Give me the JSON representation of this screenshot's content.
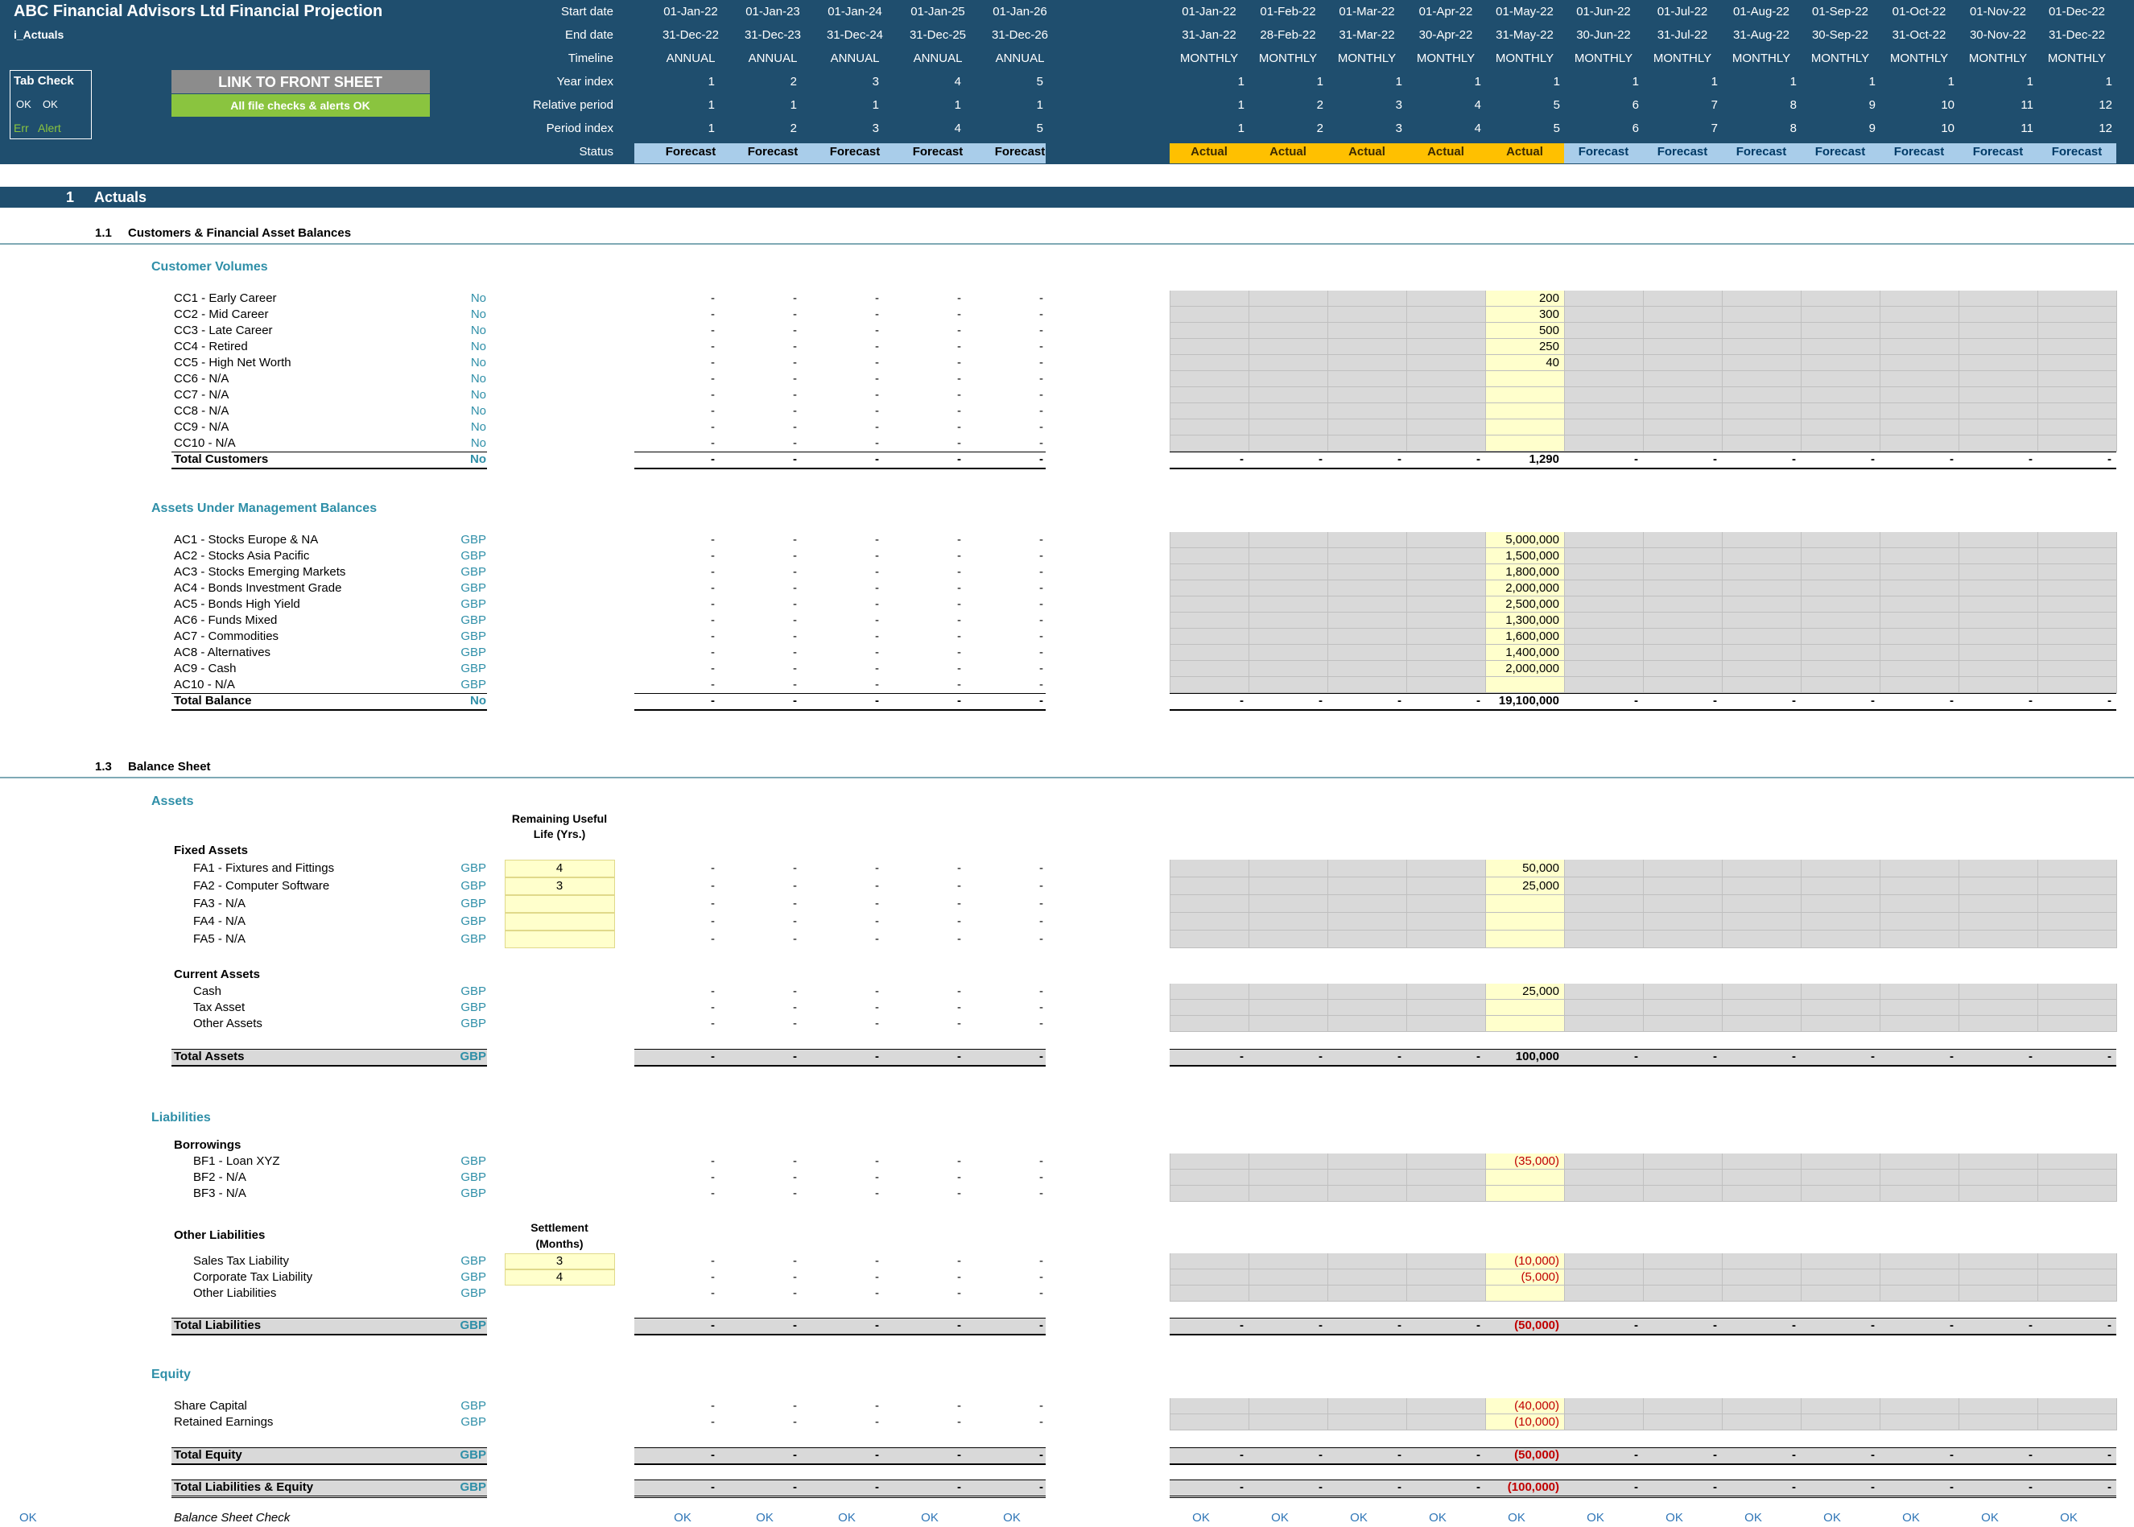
{
  "header": {
    "title": "ABC Financial Advisors Ltd Financial Projection",
    "sheet_name": "i_Actuals",
    "tab_check": {
      "title": "Tab Check",
      "ok_label": "OK",
      "ok_value": "OK",
      "err_label": "Err",
      "err_value": "Alert"
    },
    "link_button": "LINK TO FRONT SHEET",
    "checks_status": "All file checks & alerts OK",
    "row_labels": {
      "start": "Start date",
      "end": "End date",
      "timeline": "Timeline",
      "year_index": "Year index",
      "relative": "Relative period",
      "period_index": "Period index",
      "status": "Status"
    }
  },
  "annual_periods": [
    {
      "start": "01-Jan-22",
      "end": "31-Dec-22",
      "timeline": "ANNUAL",
      "year": "1",
      "relative": "1",
      "period": "1",
      "status": "Forecast"
    },
    {
      "start": "01-Jan-23",
      "end": "31-Dec-23",
      "timeline": "ANNUAL",
      "year": "2",
      "relative": "1",
      "period": "2",
      "status": "Forecast"
    },
    {
      "start": "01-Jan-24",
      "end": "31-Dec-24",
      "timeline": "ANNUAL",
      "year": "3",
      "relative": "1",
      "period": "3",
      "status": "Forecast"
    },
    {
      "start": "01-Jan-25",
      "end": "31-Dec-25",
      "timeline": "ANNUAL",
      "year": "4",
      "relative": "1",
      "period": "4",
      "status": "Forecast"
    },
    {
      "start": "01-Jan-26",
      "end": "31-Dec-26",
      "timeline": "ANNUAL",
      "year": "5",
      "relative": "1",
      "period": "5",
      "status": "Forecast"
    }
  ],
  "monthly_periods": [
    {
      "start": "01-Jan-22",
      "end": "31-Jan-22",
      "timeline": "MONTHLY",
      "year": "1",
      "relative": "1",
      "period": "1",
      "status": "Actual"
    },
    {
      "start": "01-Feb-22",
      "end": "28-Feb-22",
      "timeline": "MONTHLY",
      "year": "1",
      "relative": "2",
      "period": "2",
      "status": "Actual"
    },
    {
      "start": "01-Mar-22",
      "end": "31-Mar-22",
      "timeline": "MONTHLY",
      "year": "1",
      "relative": "3",
      "period": "3",
      "status": "Actual"
    },
    {
      "start": "01-Apr-22",
      "end": "30-Apr-22",
      "timeline": "MONTHLY",
      "year": "1",
      "relative": "4",
      "period": "4",
      "status": "Actual"
    },
    {
      "start": "01-May-22",
      "end": "31-May-22",
      "timeline": "MONTHLY",
      "year": "1",
      "relative": "5",
      "period": "5",
      "status": "Actual"
    },
    {
      "start": "01-Jun-22",
      "end": "30-Jun-22",
      "timeline": "MONTHLY",
      "year": "1",
      "relative": "6",
      "period": "6",
      "status": "Forecast"
    },
    {
      "start": "01-Jul-22",
      "end": "31-Jul-22",
      "timeline": "MONTHLY",
      "year": "1",
      "relative": "7",
      "period": "7",
      "status": "Forecast"
    },
    {
      "start": "01-Aug-22",
      "end": "31-Aug-22",
      "timeline": "MONTHLY",
      "year": "1",
      "relative": "8",
      "period": "8",
      "status": "Forecast"
    },
    {
      "start": "01-Sep-22",
      "end": "30-Sep-22",
      "timeline": "MONTHLY",
      "year": "1",
      "relative": "9",
      "period": "9",
      "status": "Forecast"
    },
    {
      "start": "01-Oct-22",
      "end": "31-Oct-22",
      "timeline": "MONTHLY",
      "year": "1",
      "relative": "10",
      "period": "10",
      "status": "Forecast"
    },
    {
      "start": "01-Nov-22",
      "end": "30-Nov-22",
      "timeline": "MONTHLY",
      "year": "1",
      "relative": "11",
      "period": "11",
      "status": "Forecast"
    },
    {
      "start": "01-Dec-22",
      "end": "31-Dec-22",
      "timeline": "MONTHLY",
      "year": "1",
      "relative": "12",
      "period": "12",
      "status": "Forecast"
    }
  ],
  "section": {
    "number": "1",
    "title": "Actuals"
  },
  "subsections": [
    {
      "number": "1.1",
      "title": "Customers & Financial Asset Balances"
    },
    {
      "number": "1.3",
      "title": "Balance Sheet"
    }
  ],
  "blocks": {
    "customer_volumes": {
      "title": "Customer Volumes",
      "rows": [
        {
          "label": "CC1 - Early Career",
          "unit": "No",
          "input": "200"
        },
        {
          "label": "CC2 - Mid Career",
          "unit": "No",
          "input": "300"
        },
        {
          "label": "CC3 - Late Career",
          "unit": "No",
          "input": "500"
        },
        {
          "label": "CC4 - Retired",
          "unit": "No",
          "input": "250"
        },
        {
          "label": "CC5 - High Net Worth",
          "unit": "No",
          "input": "40"
        },
        {
          "label": "CC6 - N/A",
          "unit": "No",
          "input": ""
        },
        {
          "label": "CC7 - N/A",
          "unit": "No",
          "input": ""
        },
        {
          "label": "CC8 - N/A",
          "unit": "No",
          "input": ""
        },
        {
          "label": "CC9 - N/A",
          "unit": "No",
          "input": ""
        },
        {
          "label": "CC10 - N/A",
          "unit": "No",
          "input": ""
        }
      ],
      "total": {
        "label": "Total Customers",
        "unit": "No",
        "value": "1,290"
      }
    },
    "aum": {
      "title": "Assets Under Management Balances",
      "rows": [
        {
          "label": "AC1 - Stocks Europe & NA",
          "unit": "GBP",
          "input": "5,000,000"
        },
        {
          "label": "AC2 - Stocks Asia Pacific",
          "unit": "GBP",
          "input": "1,500,000"
        },
        {
          "label": "AC3 - Stocks Emerging Markets",
          "unit": "GBP",
          "input": "1,800,000"
        },
        {
          "label": "AC4 - Bonds Investment Grade",
          "unit": "GBP",
          "input": "2,000,000"
        },
        {
          "label": "AC5 - Bonds High Yield",
          "unit": "GBP",
          "input": "2,500,000"
        },
        {
          "label": "AC6 - Funds Mixed",
          "unit": "GBP",
          "input": "1,300,000"
        },
        {
          "label": "AC7 - Commodities",
          "unit": "GBP",
          "input": "1,600,000"
        },
        {
          "label": "AC8 - Alternatives",
          "unit": "GBP",
          "input": "1,400,000"
        },
        {
          "label": "AC9 - Cash",
          "unit": "GBP",
          "input": "2,000,000"
        },
        {
          "label": "AC10 - N/A",
          "unit": "GBP",
          "input": ""
        }
      ],
      "total": {
        "label": "Total Balance",
        "unit": "No",
        "value": "19,100,000"
      }
    },
    "assets": {
      "title": "Assets",
      "rul_header_1": "Remaining Useful",
      "rul_header_2": "Life (Yrs.)",
      "fixed_title": "Fixed Assets",
      "fixed_rows": [
        {
          "label": "FA1 - Fixtures and Fittings",
          "unit": "GBP",
          "extra": "4",
          "input": "50,000"
        },
        {
          "label": "FA2 - Computer Software",
          "unit": "GBP",
          "extra": "3",
          "input": "25,000"
        },
        {
          "label": "FA3 - N/A",
          "unit": "GBP",
          "extra": "",
          "input": ""
        },
        {
          "label": "FA4 - N/A",
          "unit": "GBP",
          "extra": "",
          "input": ""
        },
        {
          "label": "FA5 - N/A",
          "unit": "GBP",
          "extra": "",
          "input": ""
        }
      ],
      "current_title": "Current Assets",
      "current_rows": [
        {
          "label": "Cash",
          "unit": "GBP",
          "input": "25,000"
        },
        {
          "label": "Tax Asset",
          "unit": "GBP",
          "input": ""
        },
        {
          "label": "Other Assets",
          "unit": "GBP",
          "input": ""
        }
      ],
      "total": {
        "label": "Total Assets",
        "unit": "GBP",
        "value": "100,000"
      }
    },
    "liabilities": {
      "title": "Liabilities",
      "borrow_title": "Borrowings",
      "borrow_rows": [
        {
          "label": "BF1 - Loan XYZ",
          "unit": "GBP",
          "input": "(35,000)"
        },
        {
          "label": "BF2 - N/A",
          "unit": "GBP",
          "input": ""
        },
        {
          "label": "BF3 - N/A",
          "unit": "GBP",
          "input": ""
        }
      ],
      "settle_header_1": "Settlement",
      "settle_header_2": "(Months)",
      "other_title": "Other Liabilities",
      "other_rows": [
        {
          "label": "Sales Tax Liability",
          "unit": "GBP",
          "extra": "3",
          "input": "(10,000)"
        },
        {
          "label": "Corporate Tax Liability",
          "unit": "GBP",
          "extra": "4",
          "input": "(5,000)"
        },
        {
          "label": "Other Liabilities",
          "unit": "GBP",
          "extra": "",
          "input": ""
        }
      ],
      "total": {
        "label": "Total Liabilities",
        "unit": "GBP",
        "value": "(50,000)"
      }
    },
    "equity": {
      "title": "Equity",
      "rows": [
        {
          "label": "Share Capital",
          "unit": "GBP",
          "input": "(40,000)"
        },
        {
          "label": "Retained Earnings",
          "unit": "GBP",
          "input": "(10,000)"
        }
      ],
      "total": {
        "label": "Total Equity",
        "unit": "GBP",
        "value": "(50,000)"
      },
      "grand_total": {
        "label": "Total Liabilities & Equity",
        "unit": "GBP",
        "value": "(100,000)"
      }
    },
    "check": {
      "left": "OK",
      "label": "Balance Sheet Check",
      "value": "OK"
    }
  },
  "dash": "-",
  "colors": {
    "header_navy": "#1f4e6e",
    "forecast_fill": "#a9cdea",
    "actual_fill": "#ffc000",
    "input_yellow": "#ffffcc",
    "grey_cell": "#d9d9d9",
    "link_grey": "#8c8c8c",
    "ok_green": "#8ac43f",
    "teal_text": "#2f8fa8",
    "negative_red": "#c00000"
  }
}
